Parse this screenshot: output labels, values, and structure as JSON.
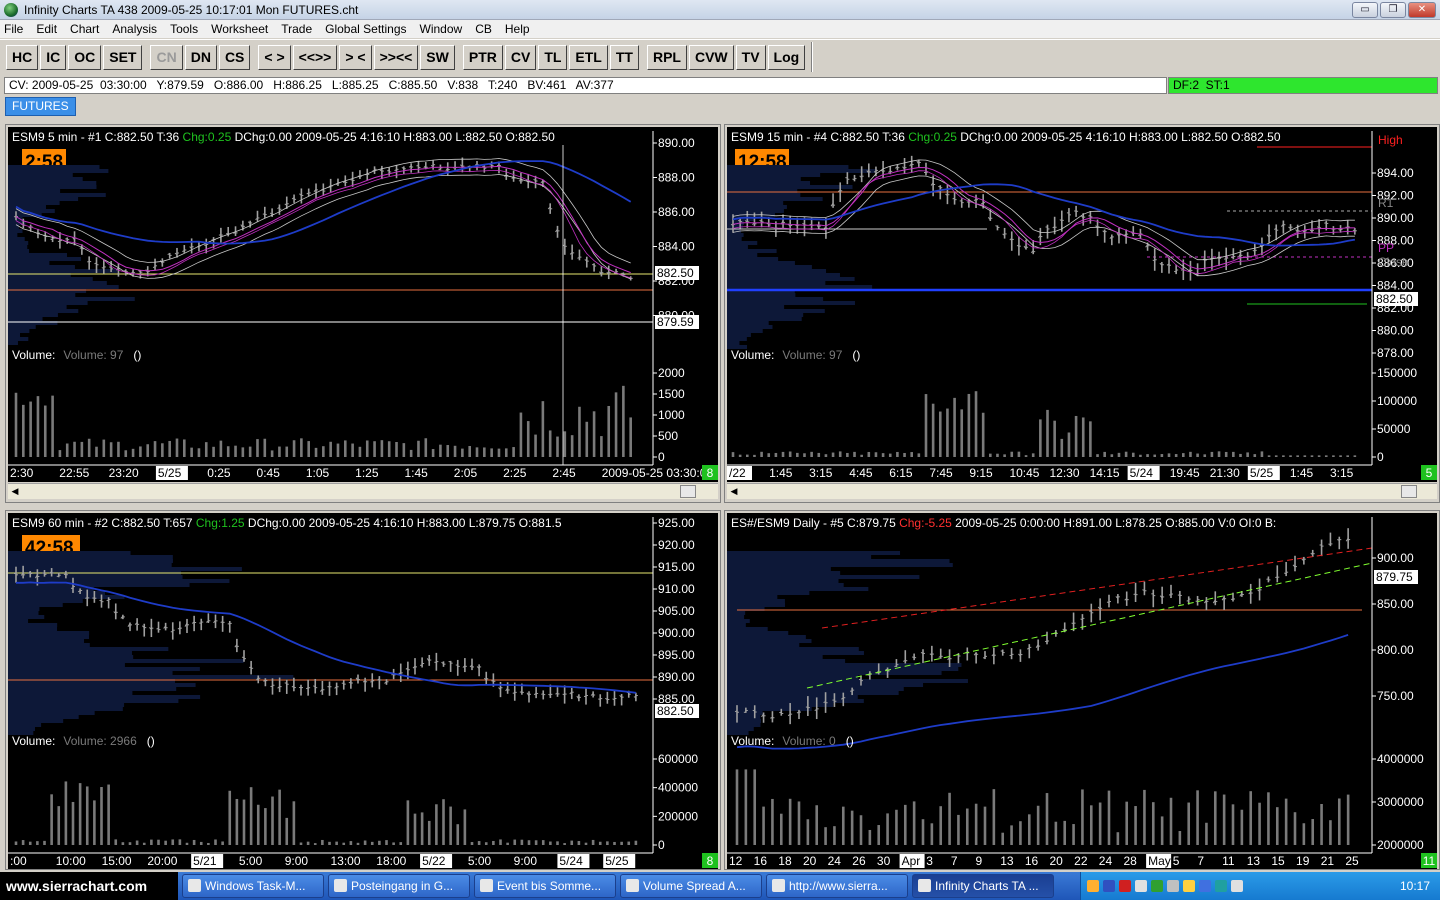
{
  "window": {
    "title": "Infinity Charts TA 438  2009-05-25  10:17:01  Mon   FUTURES.cht",
    "btn_min": "▭",
    "btn_max": "❐",
    "btn_close": "✕"
  },
  "menu": [
    "File",
    "Edit",
    "Chart",
    "Analysis",
    "Tools",
    "Worksheet",
    "Trade",
    "Global Settings",
    "Window",
    "CB",
    "Help"
  ],
  "toolbar": {
    "groups": [
      [
        "HC",
        "IC",
        "OC",
        "SET"
      ],
      [
        "CN",
        "DN",
        "CS"
      ],
      [
        "< >",
        "<<>>",
        "> <",
        ">><<",
        "SW"
      ],
      [
        "PTR",
        "CV",
        "TL",
        "ETL",
        "TT"
      ],
      [
        "RPL",
        "CVW",
        "TV",
        "Log"
      ]
    ],
    "disabled": [
      "CN"
    ]
  },
  "status": {
    "cv": "CV: 2009-05-25  03:30:00   Y:879.59   O:886.00   H:886.25   L:885.25   C:885.50   V:838   T:240   BV:461   AV:377",
    "df": "DF:2  ST:1"
  },
  "tabs": [
    "FUTURES"
  ],
  "colors": {
    "bg": "#000000",
    "bar": "#a0a0a0",
    "ma_blue": "#1e3cc8",
    "ma_magenta": "#c030c0",
    "ma_white": "#c8c8c8",
    "yellow": "#e8e870",
    "orange": "#e87040",
    "accent": "#ff8800",
    "green": "#1fc21f",
    "tick": "#ffffff"
  },
  "charts": [
    {
      "id": "c1",
      "header": [
        [
          "ESM9  5 min  - #1  C:882.50  T:36  ",
          "#fff"
        ],
        [
          "Chg:0.25",
          "#1fc21f"
        ],
        [
          "  DChg:0.00  2009-05-25  4:16:10  H:883.00  L:882.50  O:882.50",
          "#fff"
        ]
      ],
      "timer": "2:58",
      "price_ticks": [
        "890.00",
        "888.00",
        "886.00",
        "884.00",
        "882.00",
        "880.00"
      ],
      "price_tags": [
        {
          "text": "882.50"
        },
        {
          "text": "879.59"
        }
      ],
      "volume_label": "Volume:",
      "volume_value": "Volume: 97",
      "volume_paren": "()",
      "volume_ticks": [
        "2000",
        "1500",
        "1000",
        "500",
        "0"
      ],
      "time_ticks": [
        "2:30",
        "22:55",
        "23:20",
        "5/25",
        "0:25",
        "0:45",
        "1:05",
        "1:25",
        "1:45",
        "2:05",
        "2:25",
        "2:45",
        "2009-05-25  03:30:0005"
      ],
      "corner": "8",
      "chart_data": {
        "type": "bar",
        "ylim": [
          878,
          891
        ],
        "series": []
      }
    },
    {
      "id": "c2",
      "header": [
        [
          "ESM9  15 min  - #4  C:882.50  T:36  ",
          "#fff"
        ],
        [
          "Chg:0.25",
          "#1fc21f"
        ],
        [
          "  DChg:0.00  2009-05-25  4:16:10  H:883.00  L:882.50  O:882.50",
          "#fff"
        ]
      ],
      "timer": "12:58",
      "price_ticks": [
        "894.00",
        "892.00",
        "890.00",
        "888.00",
        "886.00",
        "884.00",
        "882.00",
        "880.00",
        "878.00"
      ],
      "price_tags": [
        {
          "text": "882.50"
        }
      ],
      "levels": [
        "High",
        "R1",
        "PP",
        "Close"
      ],
      "volume_label": "Volume:",
      "volume_value": "Volume: 97",
      "volume_paren": "()",
      "volume_ticks": [
        "150000",
        "100000",
        "50000",
        "0"
      ],
      "time_ticks": [
        "/22",
        "1:45",
        "3:15",
        "4:45",
        "6:15",
        "7:45",
        "9:15",
        "10:45",
        "12:30",
        "14:15",
        "5/24",
        "19:45",
        "21:30",
        "5/25",
        "1:45",
        "3:15"
      ],
      "corner": "5"
    },
    {
      "id": "c3",
      "header": [
        [
          "ESM9  60 min  - #2  C:882.50  T:657  ",
          "#fff"
        ],
        [
          "Chg:1.25",
          "#1fc21f"
        ],
        [
          "  DChg:0.00  2009-05-25  4:16:10  H:883.00  L:879.75  O:881.5",
          "#fff"
        ]
      ],
      "timer": "42:58",
      "price_ticks": [
        "925.00",
        "920.00",
        "915.00",
        "910.00",
        "905.00",
        "900.00",
        "895.00",
        "890.00",
        "885.00"
      ],
      "price_tags": [
        {
          "text": "882.50"
        }
      ],
      "volume_label": "Volume:",
      "volume_value": "Volume: 2966",
      "volume_paren": "()",
      "volume_ticks": [
        "600000",
        "400000",
        "200000",
        "0"
      ],
      "time_ticks": [
        ":00",
        "10:00",
        "15:00",
        "20:00",
        "5/21",
        "5:00",
        "9:00",
        "13:00",
        "18:00",
        "5/22",
        "5:00",
        "9:00",
        "5/24",
        "5/25"
      ],
      "corner": "8"
    },
    {
      "id": "c4",
      "header": [
        [
          "ES#/ESM9  Daily  - #5  C:879.75  ",
          "#fff"
        ],
        [
          "Chg:-5.25",
          "#ff3030"
        ],
        [
          "  2009-05-25  0:00:00  H:891.00  L:878.25  O:885.00  V:0  OI:0  B:",
          "#fff"
        ]
      ],
      "timer": "",
      "price_ticks": [
        "900.00",
        "850.00",
        "800.00",
        "750.00"
      ],
      "price_tags": [
        {
          "text": "879.75"
        }
      ],
      "volume_label": "Volume:",
      "volume_value": "Volume: 0",
      "volume_paren": "()",
      "volume_ticks": [
        "4000000",
        "3000000",
        "2000000"
      ],
      "time_ticks": [
        "12",
        "16",
        "18",
        "20",
        "24",
        "26",
        "30",
        "Apr",
        "3",
        "7",
        "9",
        "13",
        "16",
        "20",
        "22",
        "24",
        "28",
        "May",
        "5",
        "7",
        "11",
        "13",
        "15",
        "19",
        "21",
        "25"
      ],
      "corner": "11"
    }
  ],
  "taskbar": {
    "logo": "www.sierrachart.com",
    "items": [
      "Windows Task-M...",
      "Posteingang in G...",
      "Event bis Somme...",
      "Volume Spread A...",
      "http://www.sierra...",
      "Infinity Charts TA ..."
    ],
    "clock": "10:17"
  }
}
